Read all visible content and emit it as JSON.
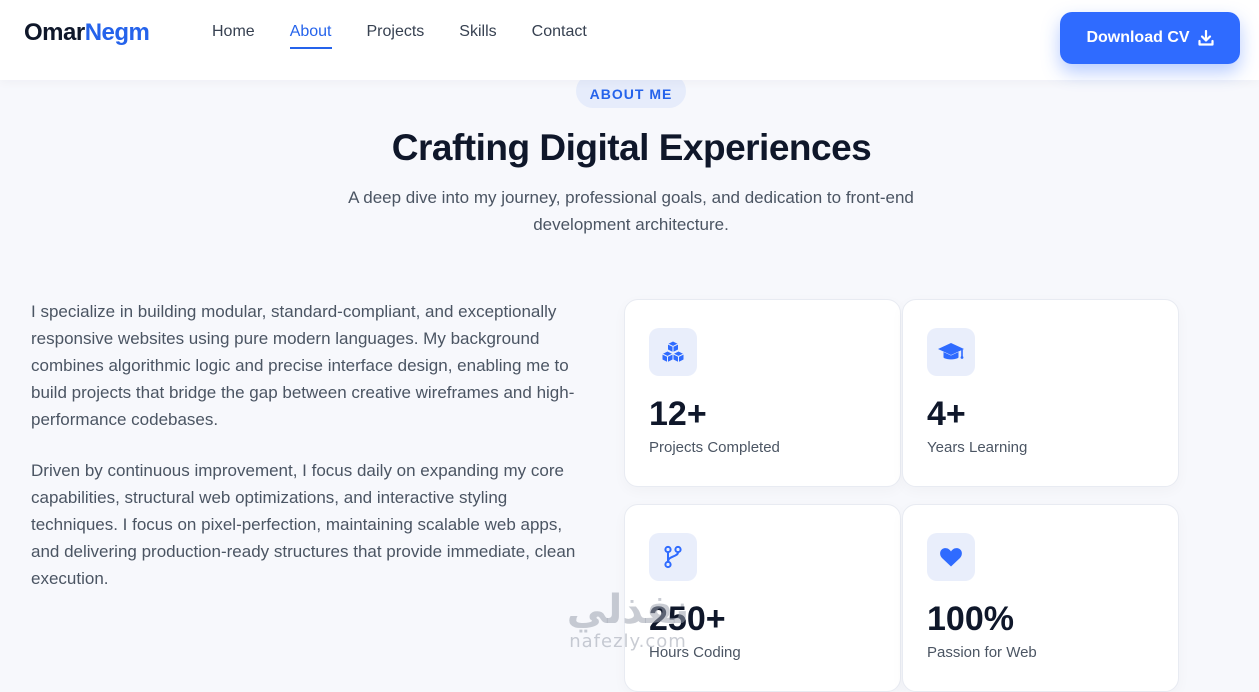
{
  "header": {
    "logo_first": "Omar",
    "logo_last": "Negm",
    "nav": [
      {
        "label": "Home",
        "active": false
      },
      {
        "label": "About",
        "active": true
      },
      {
        "label": "Projects",
        "active": false
      },
      {
        "label": "Skills",
        "active": false
      },
      {
        "label": "Contact",
        "active": false
      }
    ],
    "cta_label": "Download CV",
    "cta_icon": "download-icon"
  },
  "section": {
    "badge": "ABOUT ME",
    "title": "Crafting Digital Experiences",
    "subtitle": "A deep dive into my journey, professional goals, and dedication to front-end development architecture."
  },
  "about": {
    "paragraphs": [
      "I specialize in building modular, standard-compliant, and exceptionally responsive websites using pure modern languages. My background combines algorithmic logic and precise interface design, enabling me to build projects that bridge the gap between creative wireframes and high-performance codebases.",
      "Driven by continuous improvement, I focus daily on expanding my core capabilities, structural web optimizations, and interactive styling techniques. I focus on pixel-perfection, maintaining scalable web apps, and delivering production-ready structures that provide immediate, clean execution."
    ]
  },
  "stats": [
    {
      "value": "12+",
      "label": "Projects Completed",
      "icon": "cubes-icon"
    },
    {
      "value": "4+",
      "label": "Years Learning",
      "icon": "graduation-cap-icon"
    },
    {
      "value": "250+",
      "label": "Hours Coding",
      "icon": "code-branch-icon"
    },
    {
      "value": "100%",
      "label": "Passion for Web",
      "icon": "heart-icon"
    }
  ],
  "watermark": {
    "arabic": "نفذلي",
    "latin": "nafezly.com"
  },
  "colors": {
    "accent": "#2f6bff",
    "brand_blue": "#2563eb",
    "heading": "#0f172a",
    "body_text": "#4b5563",
    "background": "#f7f8fc",
    "badge_bg": "#e6ecfb"
  }
}
